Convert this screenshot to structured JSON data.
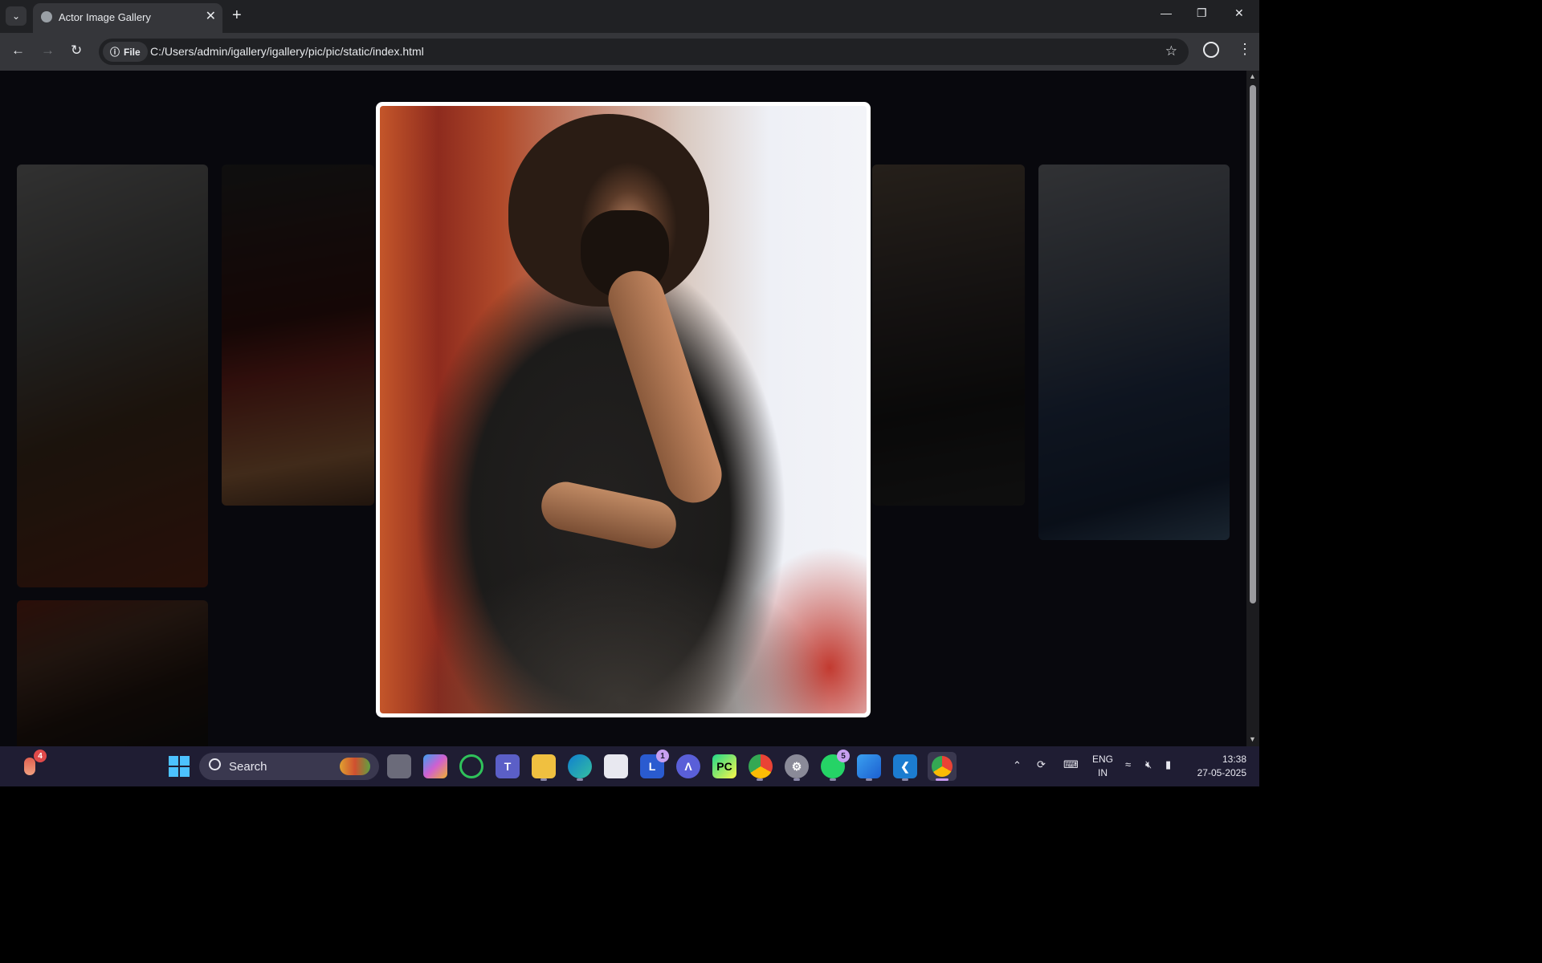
{
  "browser": {
    "tab_title": "Actor Image Gallery",
    "chip_label": "File",
    "url": "C:/Users/admin/igallery/igallery/pic/pic/static/index.html"
  },
  "taskbar": {
    "search_label": "Search",
    "notification_badge": "4",
    "l_app_badge": "1",
    "whatsapp_badge": "5",
    "lang_line1": "ENG",
    "lang_line2": "IN",
    "time": "13:38",
    "date": "27-05-2025"
  },
  "icons": {
    "tab_list": "chevron-down-icon",
    "close_tab": "close-icon",
    "new_tab": "plus-icon",
    "back": "arrow-left-icon",
    "forward": "arrow-right-icon",
    "reload": "reload-icon",
    "bookmark": "star-icon",
    "profile": "profile-icon",
    "menu": "more-vertical-icon"
  }
}
